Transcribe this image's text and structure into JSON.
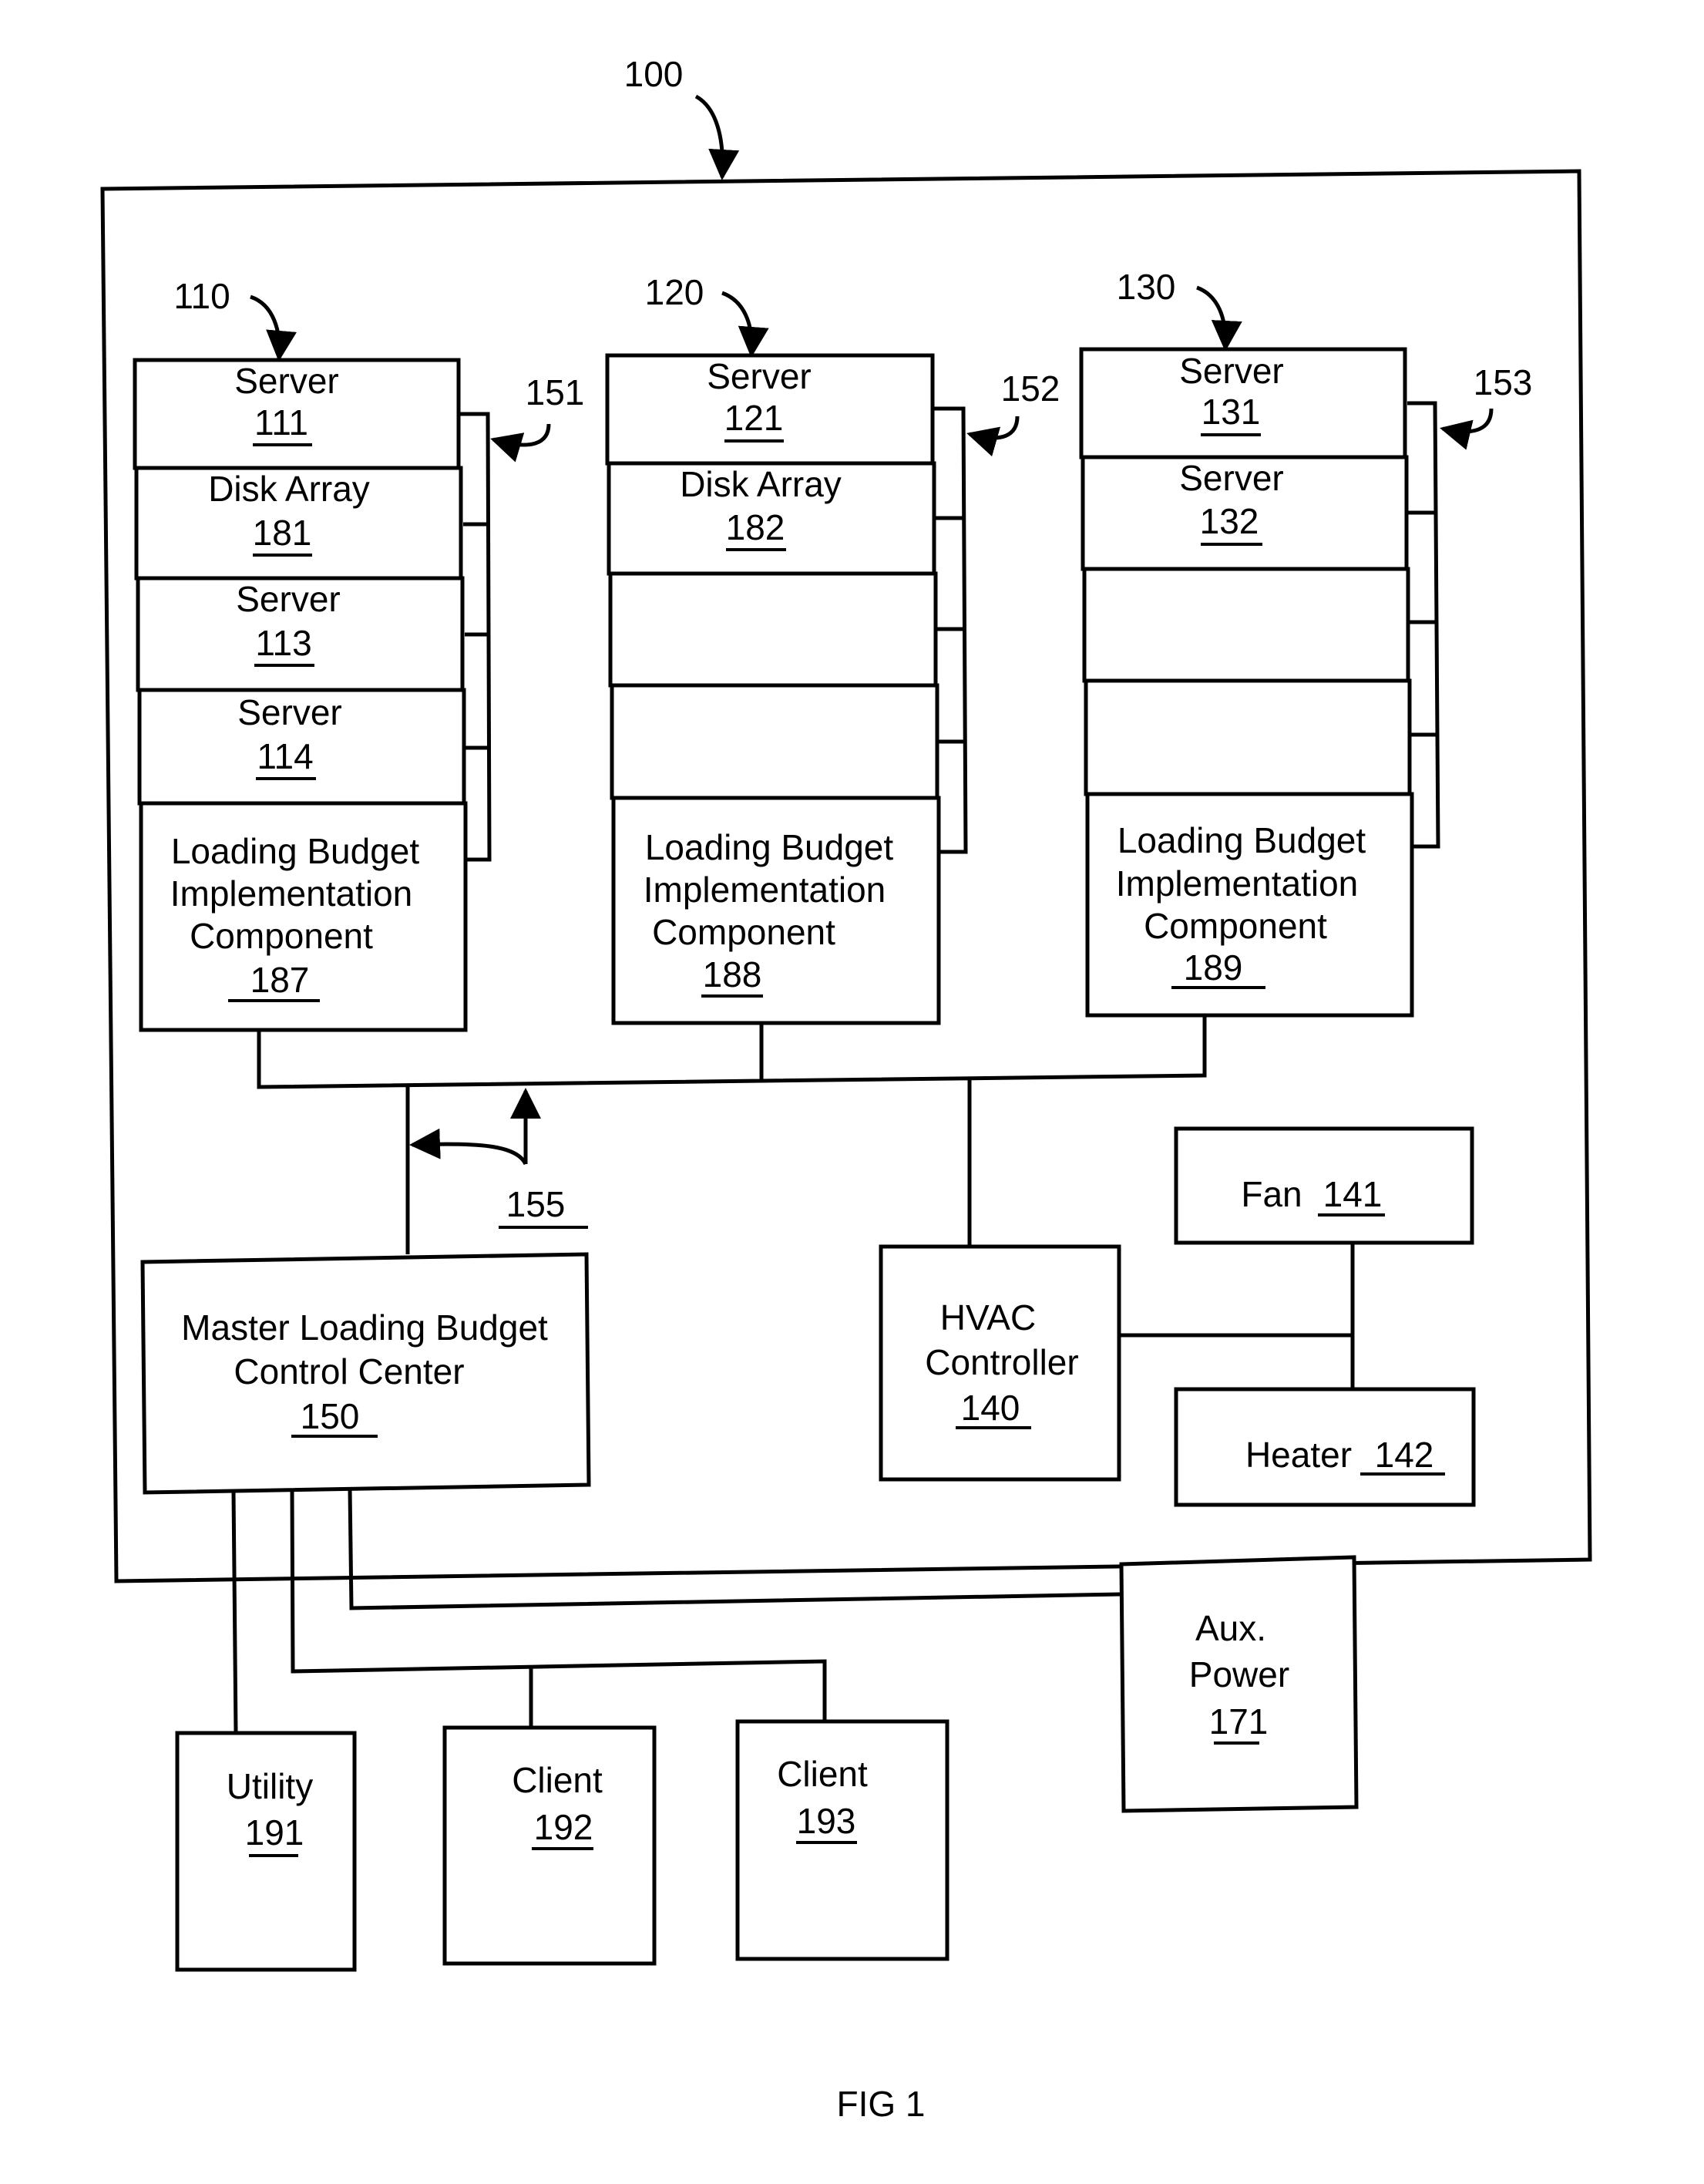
{
  "figure_label": "FIG 1",
  "system": {
    "ref": "100"
  },
  "racks": [
    {
      "ref": "110",
      "bus_ref": "151",
      "slots": [
        {
          "name": "Server",
          "num": "111"
        },
        {
          "name": "Disk Array",
          "num": "181"
        },
        {
          "name": "Server",
          "num": "113"
        },
        {
          "name": "Server",
          "num": "114"
        }
      ],
      "component": {
        "lines": [
          "Loading Budget",
          "Implementation",
          "Component"
        ],
        "num": "187"
      }
    },
    {
      "ref": "120",
      "bus_ref": "152",
      "slots": [
        {
          "name": "Server",
          "num": "121"
        },
        {
          "name": "Disk Array",
          "num": "182"
        },
        {
          "name": "",
          "num": ""
        },
        {
          "name": "",
          "num": ""
        }
      ],
      "component": {
        "lines": [
          "Loading Budget",
          "Implementation",
          "Component"
        ],
        "num": "188"
      }
    },
    {
      "ref": "130",
      "bus_ref": "153",
      "slots": [
        {
          "name": "Server",
          "num": "131"
        },
        {
          "name": "Server",
          "num": "132"
        },
        {
          "name": "",
          "num": ""
        },
        {
          "name": "",
          "num": ""
        }
      ],
      "component": {
        "lines": [
          "Loading Budget",
          "Implementation",
          "Component"
        ],
        "num": "189"
      }
    }
  ],
  "network_ref": "155",
  "master": {
    "lines": [
      "Master Loading Budget",
      "Control Center"
    ],
    "num": "150"
  },
  "hvac": {
    "lines": [
      "HVAC",
      "Controller"
    ],
    "num": "140"
  },
  "fan": {
    "name": "Fan",
    "num": "141"
  },
  "heater": {
    "name": "Heater",
    "num": "142"
  },
  "aux_power": {
    "lines": [
      "Aux.",
      "Power"
    ],
    "num": "171"
  },
  "utility": {
    "name": "Utility",
    "num": "191"
  },
  "clients": [
    {
      "name": "Client",
      "num": "192"
    },
    {
      "name": "Client",
      "num": "193"
    }
  ]
}
